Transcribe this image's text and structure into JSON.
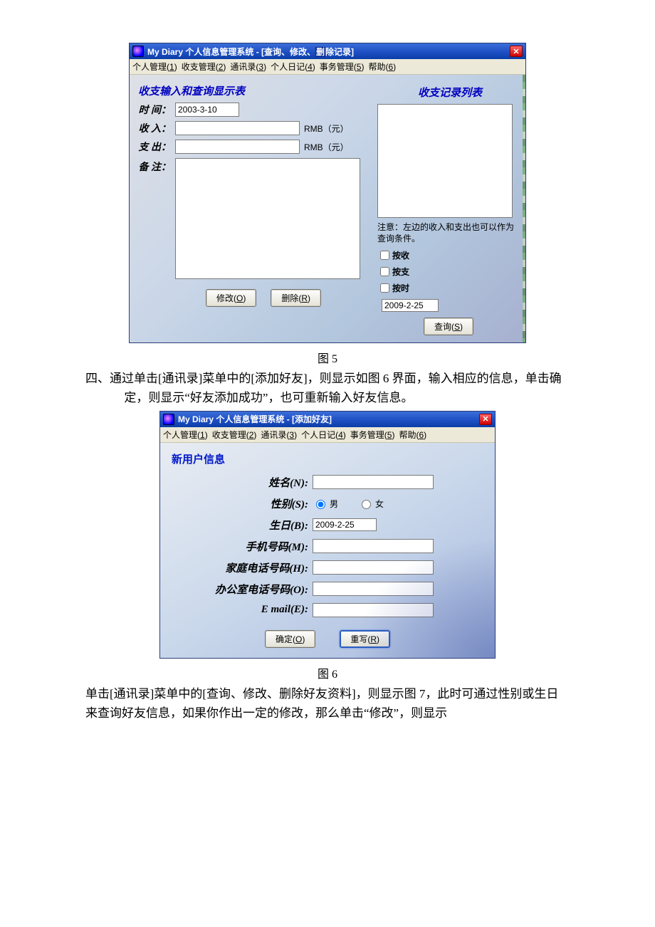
{
  "win1": {
    "title_prefix": "My Diary 个人信息管理系统 - [查询、修改、",
    "title_hl": "删",
    "title_suffix": "除记录]",
    "menu": [
      "个人管理(1)",
      "收支管理(2)",
      "通讯录(3)",
      "个人日记(4)",
      "事务管理(5)",
      "帮助(6)"
    ],
    "section_left": "收支输入和查询显示表",
    "section_right": "收支记录列表",
    "labels": {
      "time": "时 间：",
      "income": "收 入：",
      "expense": "支 出：",
      "remark": "备 注："
    },
    "time_value": "2003-3-10",
    "currency": "RMB（元）",
    "note": "注意：左边的收入和支出也可以作为查询条件。",
    "checks": {
      "by_income": "按收",
      "by_expense": "按支",
      "by_time": "按时"
    },
    "date2": "2009-2-25",
    "buttons": {
      "modify": "修改(O)",
      "delete": "删除(R)",
      "query": "查询(S)"
    }
  },
  "caption1": "图 5",
  "paragraph1": "四、通过单击[通讯录]菜单中的[添加好友]，则显示如图 6 界面，输入相应的信息，单击确定，则显示“好友添加成功”，也可重新输入好友信息。",
  "win2": {
    "title": "My Diary 个人信息管理系统 - [添加好友]",
    "menu": [
      "个人管理(1)",
      "收支管理(2)",
      "通讯录(3)",
      "个人日记(4)",
      "事务管理(5)",
      "帮助(6)"
    ],
    "heading": "新用户信息",
    "labels": {
      "name": "姓名(N):",
      "gender": "性别(S):",
      "birthday": "生日(B):",
      "mobile": "手机号码(M):",
      "home": "家庭电话号码(H):",
      "office": "办公室电话号码(O):",
      "email": "E mail(E):"
    },
    "gender_options": {
      "male": "男",
      "female": "女"
    },
    "birthday_value": "2009-2-25",
    "buttons": {
      "ok": "确定(O)",
      "rewrite": "重写(R)"
    }
  },
  "caption2": "图 6",
  "paragraph2": "单击[通讯录]菜单中的[查询、修改、删除好友资料]，则显示图 7，此时可通过性别或生日来查询好友信息，如果你作出一定的修改，那么单击“修改”，则显示"
}
